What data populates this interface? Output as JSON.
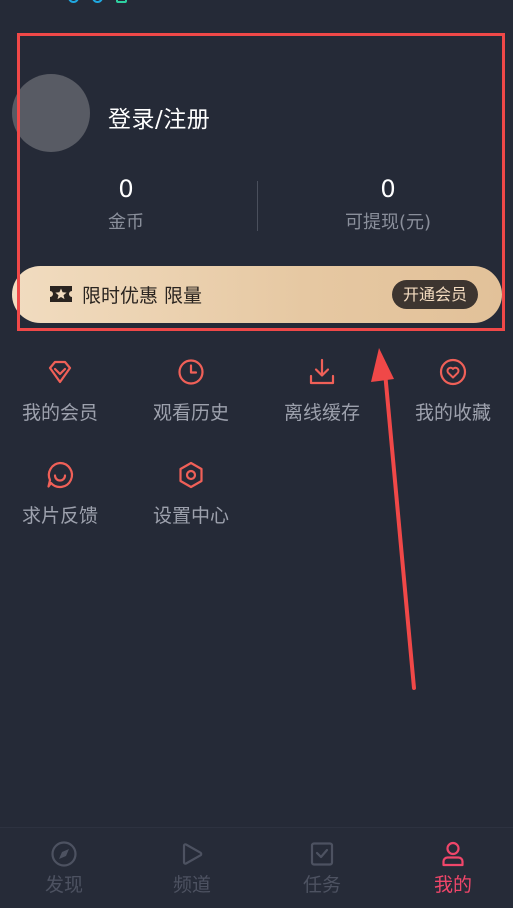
{
  "profile": {
    "login_label": "登录/注册"
  },
  "stats": {
    "coins": {
      "value": "0",
      "label": "金币"
    },
    "cash": {
      "value": "0",
      "label": "可提现(元)"
    }
  },
  "vip_banner": {
    "text": "限时优惠 限量",
    "button_label": "开通会员"
  },
  "menu": [
    {
      "label": "我的会员",
      "icon": "diamond-icon"
    },
    {
      "label": "观看历史",
      "icon": "clock-icon"
    },
    {
      "label": "离线缓存",
      "icon": "download-icon"
    },
    {
      "label": "我的收藏",
      "icon": "heart-icon"
    },
    {
      "label": "求片反馈",
      "icon": "smile-bubble-icon"
    },
    {
      "label": "设置中心",
      "icon": "settings-hex-icon"
    }
  ],
  "bottom_nav": [
    {
      "label": "发现",
      "icon": "compass-icon",
      "active": false
    },
    {
      "label": "频道",
      "icon": "play-icon",
      "active": false
    },
    {
      "label": "任务",
      "icon": "task-check-icon",
      "active": false
    },
    {
      "label": "我的",
      "icon": "user-icon",
      "active": true
    }
  ],
  "colors": {
    "background": "#252a37",
    "accent": "#f0466a",
    "icon_red": "#f06058",
    "annotation_red": "#f04848",
    "vip_gold": "#e6c8a2"
  }
}
